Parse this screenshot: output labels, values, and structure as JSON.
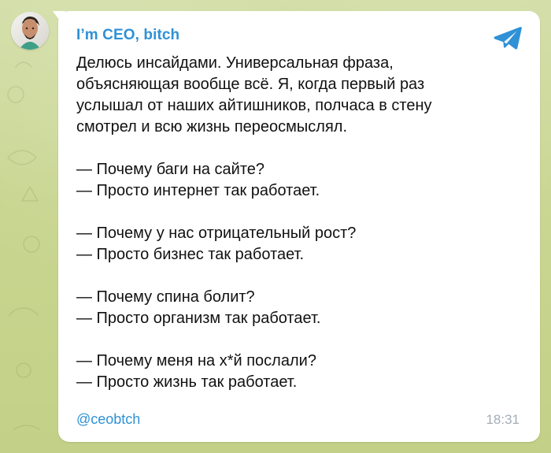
{
  "channel": {
    "name": "I’m CEO, bitch",
    "handle": "@ceobtch"
  },
  "message": {
    "intro": [
      "Делюсь инсайдами. Универсальная фраза,",
      "объясняющая вообще всё. Я, когда первый раз",
      "услышал от наших айтишников, полчаса в стену",
      "смотрел и всю жизнь переосмыслял."
    ],
    "exchanges": [
      [
        "— Почему баги на сайте?",
        "— Просто интернет так работает."
      ],
      [
        "— Почему у нас отрицательный рост?",
        "— Просто бизнес так работает."
      ],
      [
        "— Почему спина болит?",
        "— Просто организм так работает."
      ],
      [
        "— Почему меня на х*й послали?",
        "— Просто жизнь так работает."
      ]
    ],
    "time": "18:31"
  },
  "icons": {
    "avatar": "avatar-photo",
    "share": "telegram-paper-plane-icon"
  },
  "colors": {
    "background": "#c9d69a",
    "bubble": "#ffffff",
    "accent": "#2f91d6",
    "text": "#111111",
    "timestamp": "#a5adb6"
  }
}
